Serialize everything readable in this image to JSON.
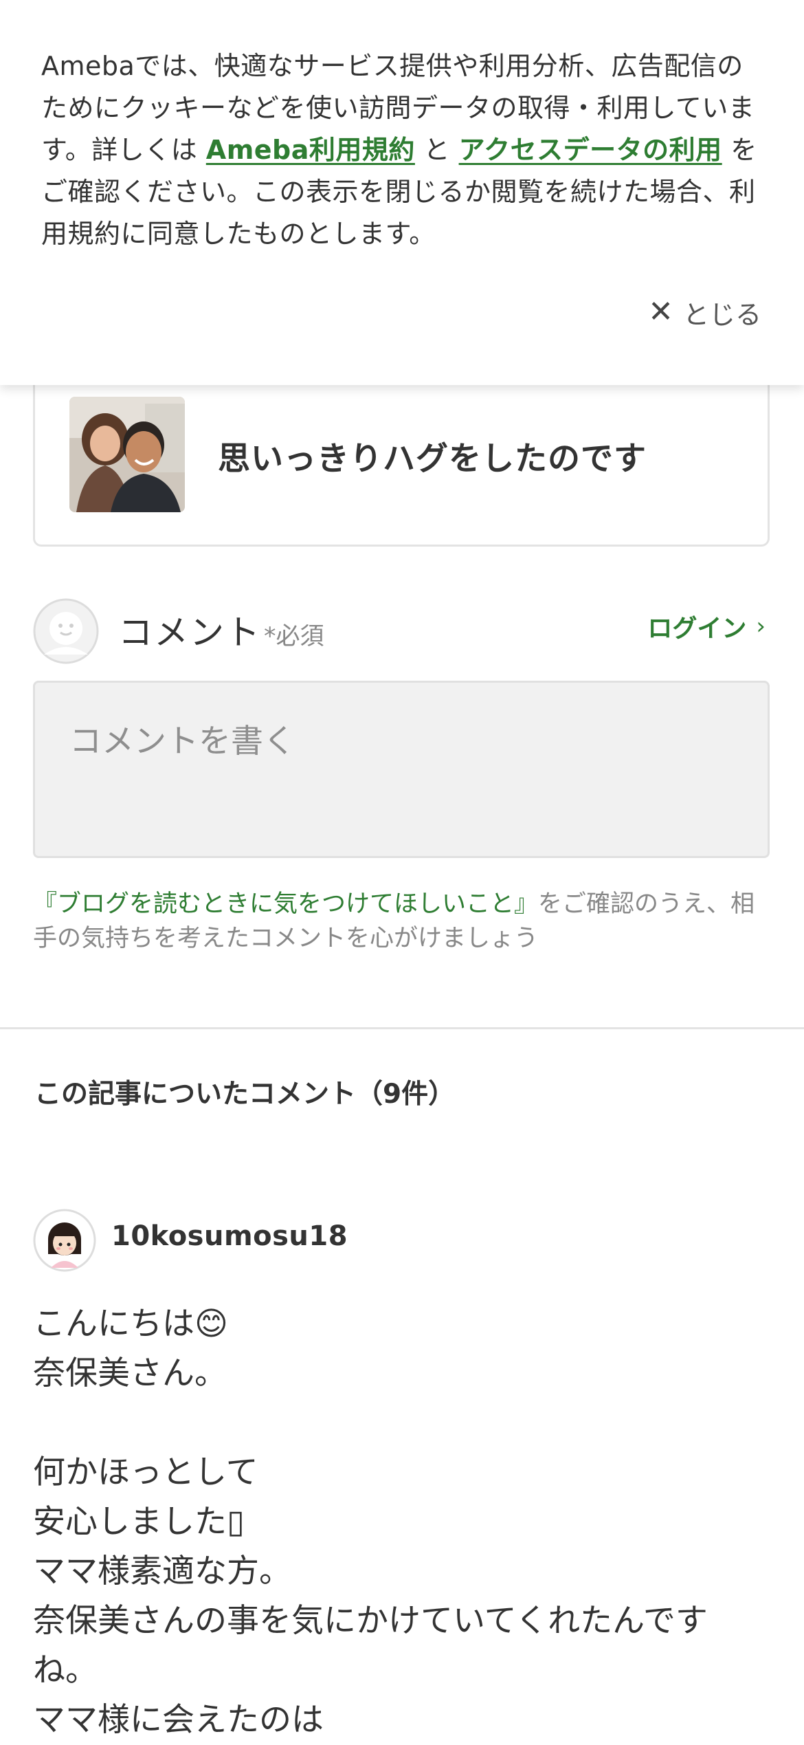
{
  "cookie_banner": {
    "text_before": "Amebaでは、快適なサービス提供や利用分析、広告配信のためにクッキーなどを使い訪問データの取得・利用しています。詳しくは ",
    "link_terms": "Ameba利用規約",
    "text_middle": " と ",
    "link_access": "アクセスデータの利用",
    "text_after": " をご確認ください。この表示を閉じるか閲覧を続けた場合、利用規約に同意したものとします。",
    "close_label": "とじる",
    "close_icon": "close-icon"
  },
  "article_card": {
    "title": "思いっきりハグをしたのです"
  },
  "comment_form": {
    "title": "コメント",
    "required": "*必須",
    "login_label": "ログイン",
    "placeholder": "コメントを書く",
    "note_link": "『ブログを読むときに気をつけてほしいこと』",
    "note_text": "をご確認のうえ、相手の気持ちを考えたコメントを心がけましょう"
  },
  "comments": {
    "heading": "この記事についたコメント（9件）",
    "items": [
      {
        "username": "10kosumosu18",
        "lines": [
          "こんにちは😊",
          "奈保美さん。",
          "",
          "何かほっとして",
          "安心しました▯",
          "ママ様素適な方。",
          "奈保美さんの事を気にかけていてくれたんです",
          "ね。",
          "ママ様に会えたのは"
        ]
      }
    ]
  },
  "colors": {
    "accent_green": "#2e7d32",
    "text": "#333333",
    "muted": "#888888",
    "input_bg": "#f1f1f1"
  }
}
